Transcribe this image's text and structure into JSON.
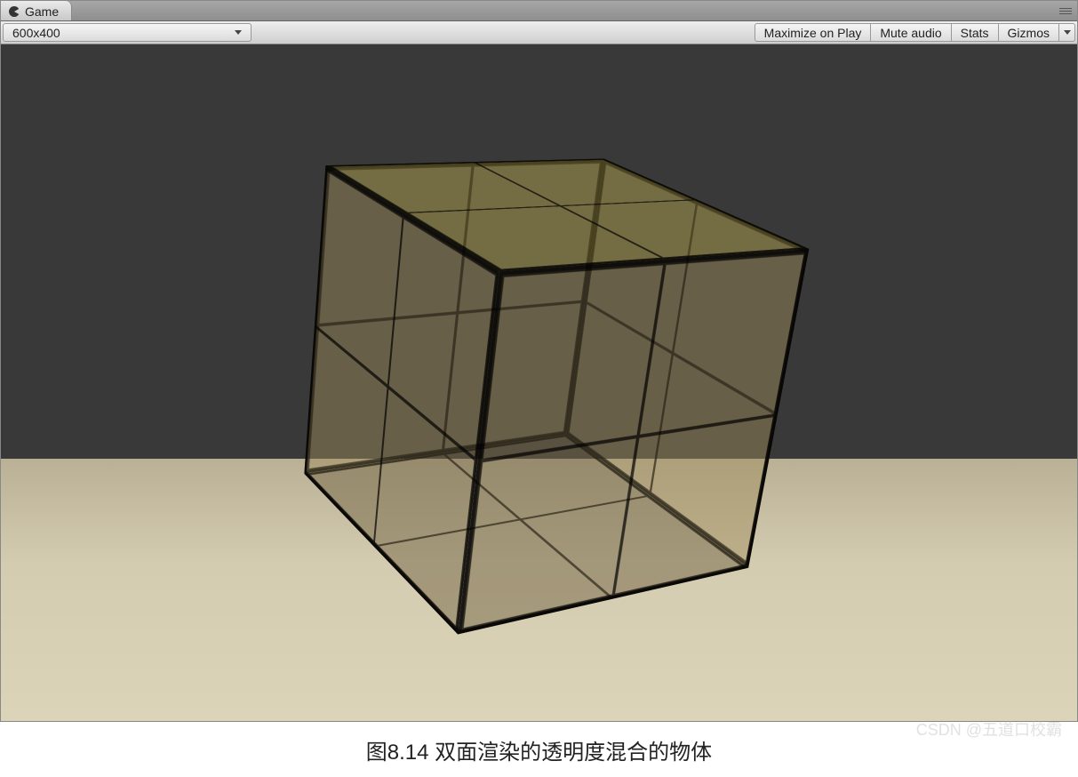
{
  "tab": {
    "title": "Game",
    "icon": "pacman-icon"
  },
  "toolbar": {
    "resolution_dropdown": {
      "value": "600x400"
    },
    "maximize_label": "Maximize on Play",
    "mute_label": "Mute audio",
    "stats_label": "Stats",
    "gizmos_label": "Gizmos"
  },
  "scene": {
    "background_color": "#393939",
    "ground_color": "#d4ccb0",
    "object": "transparent-cube",
    "cube_grid": "2x2",
    "cube_tint": "rgba(160,140,90,0.3)"
  },
  "caption": "图8.14 双面渲染的透明度混合的物体",
  "watermark": "CSDN @五道口校霸"
}
